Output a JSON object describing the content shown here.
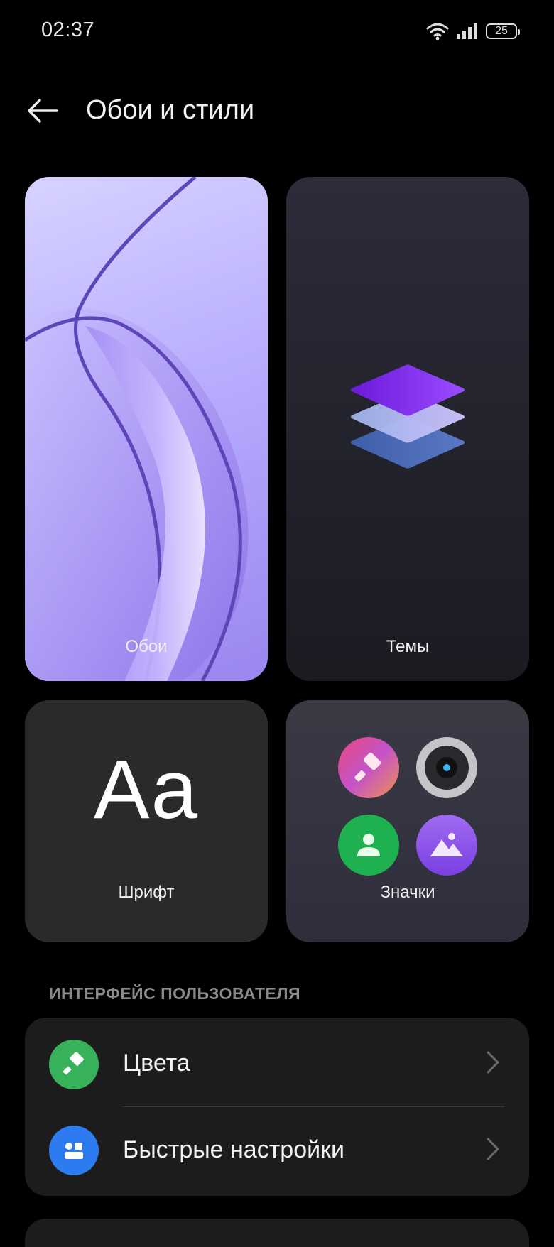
{
  "status_bar": {
    "time": "02:37",
    "battery": "25"
  },
  "header": {
    "title": "Обои и стили"
  },
  "cards": {
    "wallpaper": "Обои",
    "themes": "Темы",
    "font": "Шрифт",
    "font_sample": "Aa",
    "icons": "Значки"
  },
  "section": {
    "title": "ИНТЕРФЕЙС ПОЛЬЗОВАТЕЛЯ",
    "items": [
      {
        "label": "Цвета",
        "icon": "paintbrush-icon",
        "color": "#37b25a"
      },
      {
        "label": "Быстрые настройки",
        "icon": "quick-settings-icon",
        "color": "#2c7bf0"
      }
    ]
  }
}
